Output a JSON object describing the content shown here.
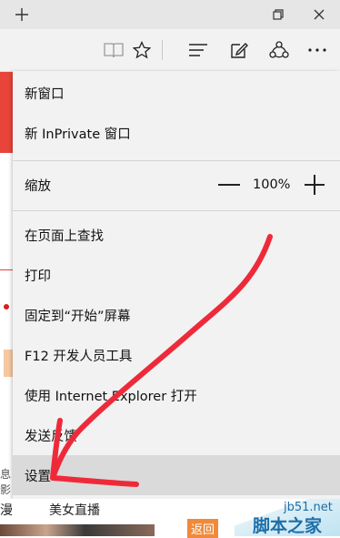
{
  "titlebar": {
    "new_tab_icon": "plus-icon",
    "window_icons": [
      "restore-icon",
      "close-icon"
    ]
  },
  "toolbar": {
    "icons": [
      "reading-view-icon",
      "favorite-star-icon",
      "hub-icon",
      "web-note-icon",
      "share-icon",
      "more-icon"
    ]
  },
  "menu": {
    "items": [
      {
        "label": "新窗口"
      },
      {
        "label": "新 InPrivate 窗口"
      },
      {
        "label": "缩放"
      },
      {
        "label": "在页面上查找"
      },
      {
        "label": "打印"
      },
      {
        "label": "固定到“开始”屏幕"
      },
      {
        "label": "F12 开发人员工具"
      },
      {
        "label": "使用 Internet Explorer 打开"
      },
      {
        "label": "发送反馈"
      },
      {
        "label": "设置"
      }
    ],
    "zoom": {
      "minus": "—",
      "value": "100%",
      "plus": "+"
    }
  },
  "background_page": {
    "tab_left": "漫",
    "tab_link": "美女直播",
    "back_badge": "返回",
    "left_text": "息影",
    "watermark_url": "jb51.net",
    "watermark_name": "脚本之家"
  },
  "colors": {
    "menu_bg": "#f2f2f2",
    "highlight": "#dadada",
    "annotation_red": "#ee2a3a"
  }
}
